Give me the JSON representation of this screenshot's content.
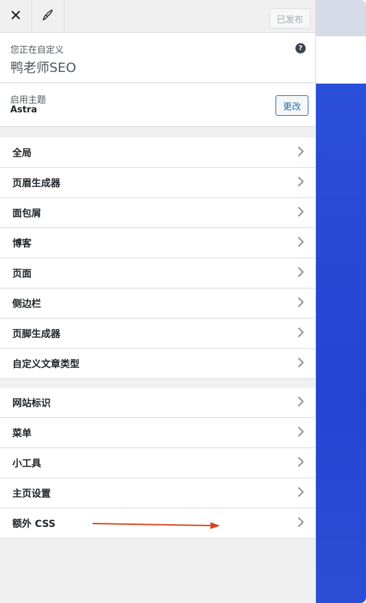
{
  "topbar": {
    "close_icon": "close-icon",
    "customize_icon": "brush-icon",
    "publish_label": "已发布"
  },
  "info": {
    "label": "您正在自定义",
    "site_name": "鸭老师SEO",
    "help": "?"
  },
  "theme": {
    "label": "启用主题",
    "name": "Astra",
    "change_label": "更改"
  },
  "sections_primary": [
    {
      "label": "全局"
    },
    {
      "label": "页眉生成器"
    },
    {
      "label": "面包屑"
    },
    {
      "label": "博客"
    },
    {
      "label": "页面"
    },
    {
      "label": "侧边栏"
    },
    {
      "label": "页脚生成器"
    },
    {
      "label": "自定义文章类型"
    }
  ],
  "sections_secondary": [
    {
      "label": "网站标识"
    },
    {
      "label": "菜单"
    },
    {
      "label": "小工具"
    },
    {
      "label": "主页设置"
    },
    {
      "label": "额外 CSS"
    }
  ],
  "colors": {
    "accent": "#2271b1",
    "annotation_arrow": "#d9431e",
    "preview_blue": "#2445d2"
  }
}
